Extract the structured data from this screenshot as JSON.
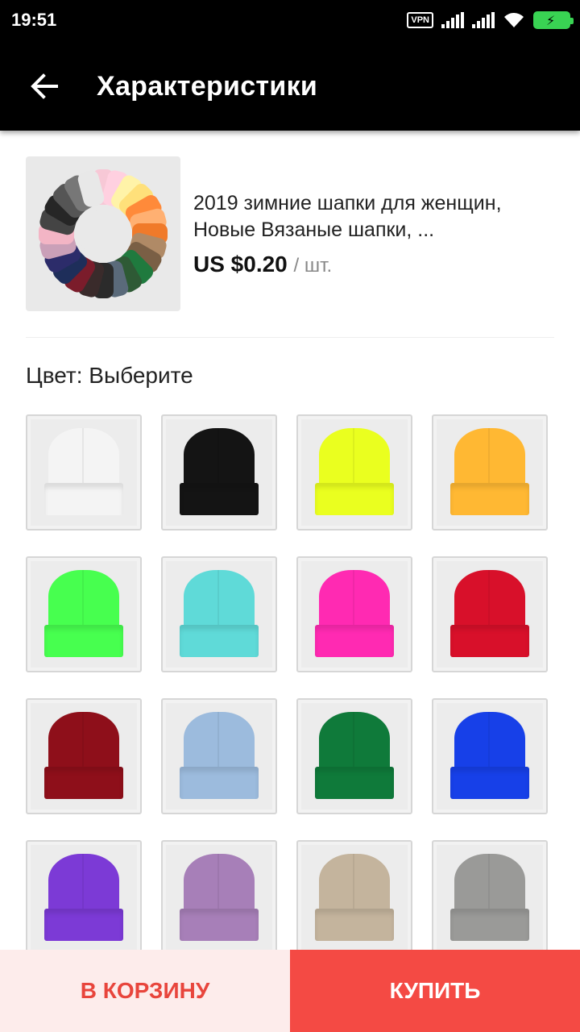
{
  "status_bar": {
    "time": "19:51",
    "vpn_label": "VPN",
    "icons": [
      "vpn-icon",
      "signal-icon",
      "signal-icon",
      "wifi-icon",
      "battery-charging-icon"
    ]
  },
  "app_bar": {
    "back_icon": "arrow-left-icon",
    "title": "Характеристики"
  },
  "product": {
    "thumbnail_icon": "hat-wreath-image",
    "title": "2019 зимние шапки для женщин, Новые Вязаные шапки, ...",
    "price": "US $0.20",
    "unit": "/ шт."
  },
  "color_section": {
    "label": "Цвет: Выберите",
    "options": [
      {
        "name": "white",
        "color": "#f4f4f4"
      },
      {
        "name": "black",
        "color": "#141414"
      },
      {
        "name": "neon-yellow",
        "color": "#eaff1f"
      },
      {
        "name": "orange-yellow",
        "color": "#ffb833"
      },
      {
        "name": "neon-green",
        "color": "#47ff4f"
      },
      {
        "name": "turquoise",
        "color": "#5fdad8"
      },
      {
        "name": "pink",
        "color": "#ff2ab2"
      },
      {
        "name": "red",
        "color": "#d8102a"
      },
      {
        "name": "burgundy",
        "color": "#8e0f1a"
      },
      {
        "name": "light-blue",
        "color": "#9cbbdd"
      },
      {
        "name": "green",
        "color": "#0f7a3a"
      },
      {
        "name": "blue",
        "color": "#1740e8"
      },
      {
        "name": "purple",
        "color": "#7c3ad6"
      },
      {
        "name": "lilac",
        "color": "#a77fb8"
      },
      {
        "name": "beige",
        "color": "#c4b49d"
      },
      {
        "name": "gray",
        "color": "#9a9a98"
      }
    ]
  },
  "actions": {
    "cart_label": "В КОРЗИНУ",
    "buy_label": "КУПИТЬ"
  },
  "colors": {
    "accent": "#f44a44",
    "cart_text": "#e8453c",
    "cart_bg": "#fdeceb",
    "app_bar": "#000000"
  }
}
